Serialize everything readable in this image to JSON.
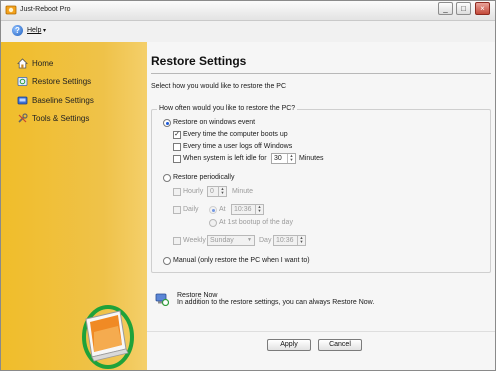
{
  "window": {
    "title": "Just-Reboot Pro",
    "controls": {
      "minimize": "_",
      "maximize": "□",
      "close": "×"
    }
  },
  "menu": {
    "help_label": "Help",
    "help_icon": "help-circle-icon",
    "dropdown_glyph": "▾"
  },
  "sidebar": {
    "background": "#f0bd2a",
    "items": [
      {
        "label": "Home",
        "icon": "home-icon"
      },
      {
        "label": "Restore Settings",
        "icon": "restore-icon"
      },
      {
        "label": "Baseline Settings",
        "icon": "baseline-icon"
      },
      {
        "label": "Tools & Settings",
        "icon": "tools-icon"
      }
    ]
  },
  "main": {
    "title": "Restore Settings",
    "subtitle": "Select how you would like to restore the PC",
    "group_label": "How often would you like to restore the PC?",
    "on_event": {
      "label": "Restore on windows event",
      "selected": true,
      "boot": {
        "label": "Every time the computer boots up",
        "checked": true
      },
      "logoff": {
        "label": "Every time a user logs off Windows",
        "checked": false
      },
      "idle": {
        "label": "When system is left idle for",
        "checked": false,
        "value": "30",
        "unit": "Minutes"
      }
    },
    "periodic": {
      "label": "Restore periodically",
      "selected": false,
      "hourly": {
        "label": "Hourly",
        "value": "0",
        "unit": "Minute"
      },
      "daily": {
        "label": "Daily",
        "at_label": "At",
        "time": "10:36",
        "boot_label": "At 1st bootup of the day"
      },
      "weekly": {
        "label": "Weekly",
        "day": "Sunday",
        "day_label": "Day",
        "time": "10:36"
      }
    },
    "manual": {
      "label": "Manual (only restore the PC when I want to)",
      "selected": false
    },
    "restore_now": {
      "title": "Restore Now",
      "description": "In addition to the restore settings, you can always Restore Now."
    },
    "buttons": {
      "apply": "Apply",
      "cancel": "Cancel"
    }
  },
  "colors": {
    "accent": "#1d5ad8",
    "sidebar": "#f0bd2a",
    "panel": "#f6f6f6"
  }
}
